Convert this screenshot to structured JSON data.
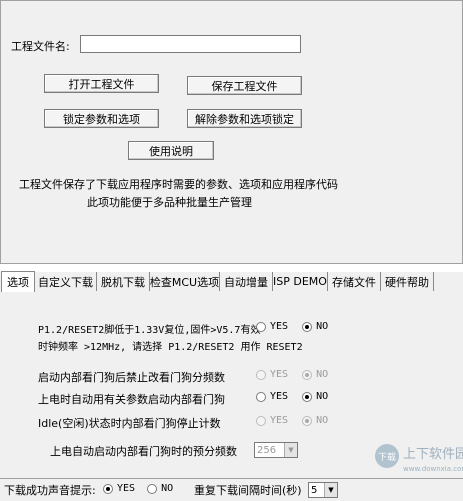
{
  "project": {
    "file_label": "工程文件名:",
    "file_value": "",
    "buttons": {
      "open": "打开工程文件",
      "save": "保存工程文件",
      "lock": "锁定参数和选项",
      "unlock": "解除参数和选项锁定",
      "help": "使用说明"
    },
    "desc_line1": "工程文件保存了下载应用程序时需要的参数、选项和应用程序代码",
    "desc_line2": "此项功能便于多品种批量生产管理"
  },
  "tabs": [
    {
      "label": "选项",
      "active": true
    },
    {
      "label": "自定义下载",
      "active": false
    },
    {
      "label": "脱机下载",
      "active": false
    },
    {
      "label": "检查MCU选项",
      "active": false
    },
    {
      "label": "自动增量",
      "active": false
    },
    {
      "label": "ISP DEMO",
      "active": false
    },
    {
      "label": "存储文件",
      "active": false
    },
    {
      "label": "硬件帮助",
      "active": false
    }
  ],
  "options": {
    "reset": {
      "line1": "P1.2/RESET2脚低于1.33V复位,固件>V5.7有效",
      "line2": "时钟频率 >12MHz, 请选择 P1.2/RESET2 用作 RESET2",
      "yes": "YES",
      "no": "NO",
      "selected": "NO"
    },
    "wdt_prescale": {
      "label": "启动内部看门狗后禁止改看门狗分频数",
      "yes": "YES",
      "no": "NO",
      "selected": "NO",
      "disabled": true
    },
    "wdt_power": {
      "label": "上电时自动用有关参数启动内部看门狗",
      "yes": "YES",
      "no": "NO",
      "selected": "NO",
      "disabled": false
    },
    "wdt_idle": {
      "label": "Idle(空闲)状态时内部看门狗停止计数",
      "yes": "YES",
      "no": "NO",
      "selected": "NO",
      "disabled": true
    },
    "wdt_div": {
      "label": "上电自动启动内部看门狗时的预分频数",
      "value": "256"
    }
  },
  "status": {
    "sound_label": "下载成功声音提示:",
    "sound_yes": "YES",
    "sound_no": "NO",
    "sound_selected": "YES",
    "interval_label": "重复下载间隔时间(秒)",
    "interval_value": "5"
  },
  "watermark": {
    "text": "下载",
    "cn": "上下软件园",
    "url": "www.downxia.com"
  }
}
